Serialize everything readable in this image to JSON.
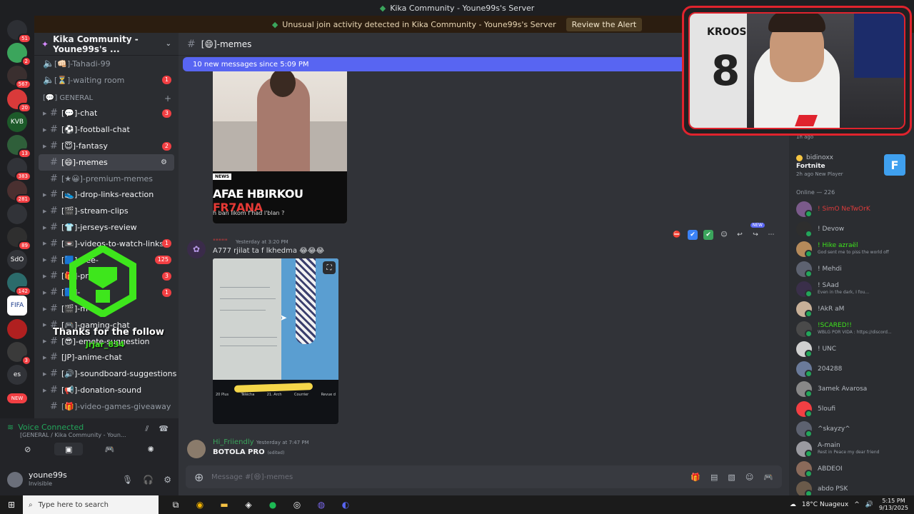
{
  "window": {
    "title": "Kika Community - Youne99s's Server"
  },
  "alert": {
    "text": "Unusual join activity detected in Kika Community - Youne99s's Server",
    "button": "Review the Alert"
  },
  "server_rail": [
    {
      "label": "",
      "badge": "51"
    },
    {
      "label": "",
      "badge": "2"
    },
    {
      "label": "",
      "badge": "567"
    },
    {
      "label": "",
      "badge": "20"
    },
    {
      "label": "KVB",
      "badge": ""
    },
    {
      "label": "",
      "badge": "13"
    },
    {
      "label": "",
      "badge": "383"
    },
    {
      "label": "",
      "badge": "281"
    },
    {
      "label": "",
      "badge": ""
    },
    {
      "label": "",
      "badge": "89"
    },
    {
      "label": "SdO",
      "badge": ""
    },
    {
      "label": "",
      "badge": "142"
    },
    {
      "label": "FIFA",
      "badge": ""
    },
    {
      "label": "",
      "badge": ""
    },
    {
      "label": "",
      "badge": "3"
    },
    {
      "label": "es",
      "badge": ""
    },
    {
      "label": "NEW",
      "badge": ""
    }
  ],
  "sidebar": {
    "server_name": "Kika Community - Youne99s's ...",
    "voice_top": [
      {
        "name": "[👊🏻]-Tahadi-99",
        "count": ""
      },
      {
        "name": "[⏳]-waiting room",
        "count": "1"
      }
    ],
    "category": "[💬] GENERAL",
    "channels": [
      {
        "name": "[💬]-chat",
        "count": "3",
        "unread": true,
        "active": false
      },
      {
        "name": "[⚽]-football-chat",
        "count": "",
        "unread": true,
        "active": false
      },
      {
        "name": "[😇]-fantasy",
        "count": "2",
        "unread": true,
        "active": false
      },
      {
        "name": "[😄]-memes",
        "count": "",
        "unread": true,
        "active": true
      },
      {
        "name": "[★😀]-premium-memes",
        "count": "",
        "unread": false,
        "active": false
      },
      {
        "name": "[👟]-drop-links-reaction",
        "count": "",
        "unread": true,
        "active": false
      },
      {
        "name": "[🎬]-stream-clips",
        "count": "",
        "unread": true,
        "active": false
      },
      {
        "name": "[👕]-jerseys-review",
        "count": "",
        "unread": true,
        "active": false
      },
      {
        "name": "[📼]-videos-to-watch-links",
        "count": "1",
        "unread": true,
        "active": false
      },
      {
        "name": "[🟦]-free-",
        "count": "125",
        "unread": true,
        "active": false
      },
      {
        "name": "[🎁]-pro",
        "count": "3",
        "unread": true,
        "active": false
      },
      {
        "name": "[🟦]-",
        "count": "1",
        "unread": true,
        "active": false
      },
      {
        "name": "[🎬]-m",
        "count": "",
        "unread": true,
        "active": false
      },
      {
        "name": "[🎮]-gaming-chat",
        "count": "",
        "unread": true,
        "active": false
      },
      {
        "name": "[😎]-emote-suggestion",
        "count": "",
        "unread": true,
        "active": false
      },
      {
        "name": "[JP]-anime-chat",
        "count": "",
        "unread": true,
        "active": false
      },
      {
        "name": "[🔊]-soundboard-suggestions",
        "count": "",
        "unread": true,
        "active": false
      },
      {
        "name": "[📢]-donation-sound",
        "count": "",
        "unread": true,
        "active": false
      },
      {
        "name": "[🎁]-video-games-giveaway",
        "count": "",
        "unread": false,
        "active": false
      }
    ]
  },
  "voice": {
    "title": "Voice Connected",
    "subtitle": "[GENERAL / Kika Community - Youn..."
  },
  "user": {
    "name": "youne99s",
    "status": "Invisible"
  },
  "channel_header": {
    "name": "[😄]-memes"
  },
  "new_messages_bar": "10 new messages since 5:09 PM",
  "image1": {
    "tag": "NEWS",
    "headline_a": "AFAE HBIRKOU ",
    "headline_b": "FR7ANA",
    "subline": "h ban likom f'had l'blan ?"
  },
  "message2": {
    "author": "\"\"\"\"\"",
    "time": "Yesterday at 3:20 PM",
    "text": "A777 rjilat ta f lkhedma 😂😂😂",
    "new_tag": "NEW"
  },
  "image2": {
    "bar_items": [
      "20 Plus",
      "Télécha",
      "21. Arch",
      "Courrier",
      "Revue d"
    ]
  },
  "message3": {
    "author": "Hi_Friiendly",
    "time": "Yesterday at 7:47 PM",
    "text": "BOTOLA PRO",
    "edited": "(edited)"
  },
  "composer": {
    "placeholder": "Message #[😄]-memes"
  },
  "members": {
    "top_time": "1h ago",
    "activity": {
      "user": "bidinoxx",
      "game": "Fortnite",
      "meta": "2h ago  New Player"
    },
    "online_header": "Online — 226",
    "list": [
      {
        "name": "! SimO NeTwOrK",
        "status": ""
      },
      {
        "name": "! Devow",
        "status": ""
      },
      {
        "name": "! Hike azraël",
        "status": "God sent me to piss the world off"
      },
      {
        "name": "! Mehdi",
        "status": ""
      },
      {
        "name": "! SAad",
        "status": "Even in the dark, I fou..."
      },
      {
        "name": "!AkR aM",
        "status": ""
      },
      {
        "name": "!SCARED!!",
        "status": "WBLG POR VIDA : https://discord..."
      },
      {
        "name": "!  UNC",
        "status": ""
      },
      {
        "name": "204288",
        "status": ""
      },
      {
        "name": "3amek Avarosa",
        "status": ""
      },
      {
        "name": "5loufi",
        "status": ""
      },
      {
        "name": "^skayzy^",
        "status": ""
      },
      {
        "name": "A-main",
        "status": "Rest in Peace my dear friend"
      },
      {
        "name": "ABDEOI",
        "status": ""
      },
      {
        "name": "abdo  PSK",
        "status": ""
      }
    ]
  },
  "webcam": {
    "jersey_name": "KROOS",
    "jersey_number": "8"
  },
  "overlay": {
    "thanks": "Thanks for the follow",
    "follower": "jrjar_834"
  },
  "taskbar": {
    "search_placeholder": "Type here to search",
    "weather": "18°C  Nuageux",
    "time": "5:15 PM",
    "date": "9/13/2025"
  },
  "colors": {
    "accent": "#5865f2",
    "alert_bg": "#2b1d10",
    "overlay_green": "#3ee61c",
    "cam_border": "#e0232d"
  }
}
